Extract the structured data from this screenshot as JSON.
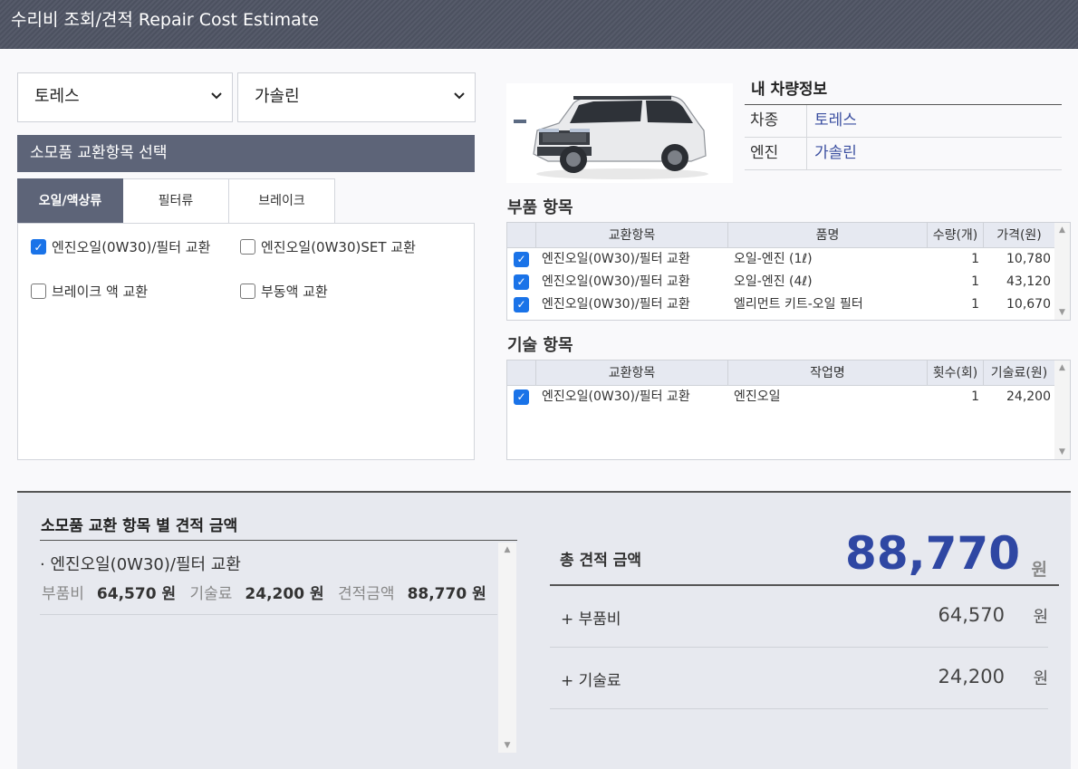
{
  "title": "수리비 조회/견적 Repair Cost Estimate",
  "selects": {
    "model": "토레스",
    "engine": "가솔린"
  },
  "consumables": {
    "header": "소모품 교환항목 선택",
    "tabs": [
      "오일/액상류",
      "필터류",
      "브레이크"
    ],
    "items": [
      {
        "label": "엔진오일(0W30)/필터 교환",
        "checked": true
      },
      {
        "label": "엔진오일(0W30)SET 교환",
        "checked": false
      },
      {
        "label": "브레이크 액 교환",
        "checked": false
      },
      {
        "label": "부동액 교환",
        "checked": false
      }
    ]
  },
  "vehicle": {
    "title": "내 차량정보",
    "rows": [
      {
        "key": "차종",
        "value": "토레스"
      },
      {
        "key": "엔진",
        "value": "가솔린"
      }
    ]
  },
  "parts": {
    "title": "부품 항목",
    "headers": [
      "교환항목",
      "품명",
      "수량(개)",
      "가격(원)"
    ],
    "rows": [
      {
        "item": "엔진오일(0W30)/필터 교환",
        "name": "오일-엔진 (1ℓ)",
        "qty": "1",
        "price": "10,780"
      },
      {
        "item": "엔진오일(0W30)/필터 교환",
        "name": "오일-엔진 (4ℓ)",
        "qty": "1",
        "price": "43,120"
      },
      {
        "item": "엔진오일(0W30)/필터 교환",
        "name": "엘리먼트 키트-오일 필터",
        "qty": "1",
        "price": "10,670"
      }
    ]
  },
  "labor": {
    "title": "기술 항목",
    "headers": [
      "교환항목",
      "작업명",
      "횟수(회)",
      "기술료(원)"
    ],
    "rows": [
      {
        "item": "엔진오일(0W30)/필터 교환",
        "name": "엔진오일",
        "qty": "1",
        "price": "24,200"
      }
    ]
  },
  "summary": {
    "title": "소모품 교환 항목 별 견적 금액",
    "item_name": "· 엔진오일(0W30)/필터 교환",
    "parts_label": "부품비",
    "parts_value": "64,570 원",
    "labor_label": "기술료",
    "labor_value": "24,200 원",
    "estimate_label": "견적금액",
    "estimate_value": "88,770 원",
    "total_label": "총 견적 금액",
    "total_value": "88,770",
    "total_unit": "원",
    "sub_parts_label": "+ 부품비",
    "sub_parts_value": "64,570",
    "sub_parts_unit": "원",
    "sub_labor_label": "+ 기술료",
    "sub_labor_value": "24,200",
    "sub_labor_unit": "원"
  }
}
